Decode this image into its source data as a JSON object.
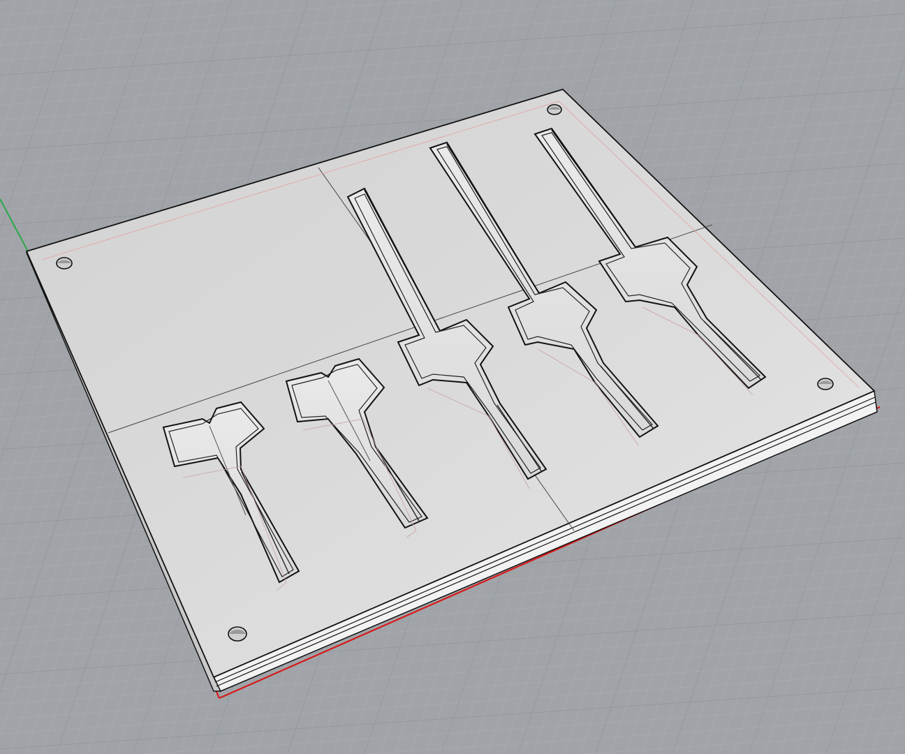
{
  "viewport": {
    "view": "Perspective",
    "display_mode": "shaded",
    "background": "#a0a4a8",
    "grid": {
      "visible": true,
      "minor_color": "#a9adb1",
      "major_color": "#8f9397"
    },
    "axes": {
      "x_color": "#d81818",
      "y_color": "#2aa84a"
    }
  },
  "model": {
    "name": "mold-plate",
    "face_color": "#d6d6d6",
    "edge_color": "#111111",
    "seam_color": "#555555",
    "through_holes": 4,
    "cavities": 5
  }
}
